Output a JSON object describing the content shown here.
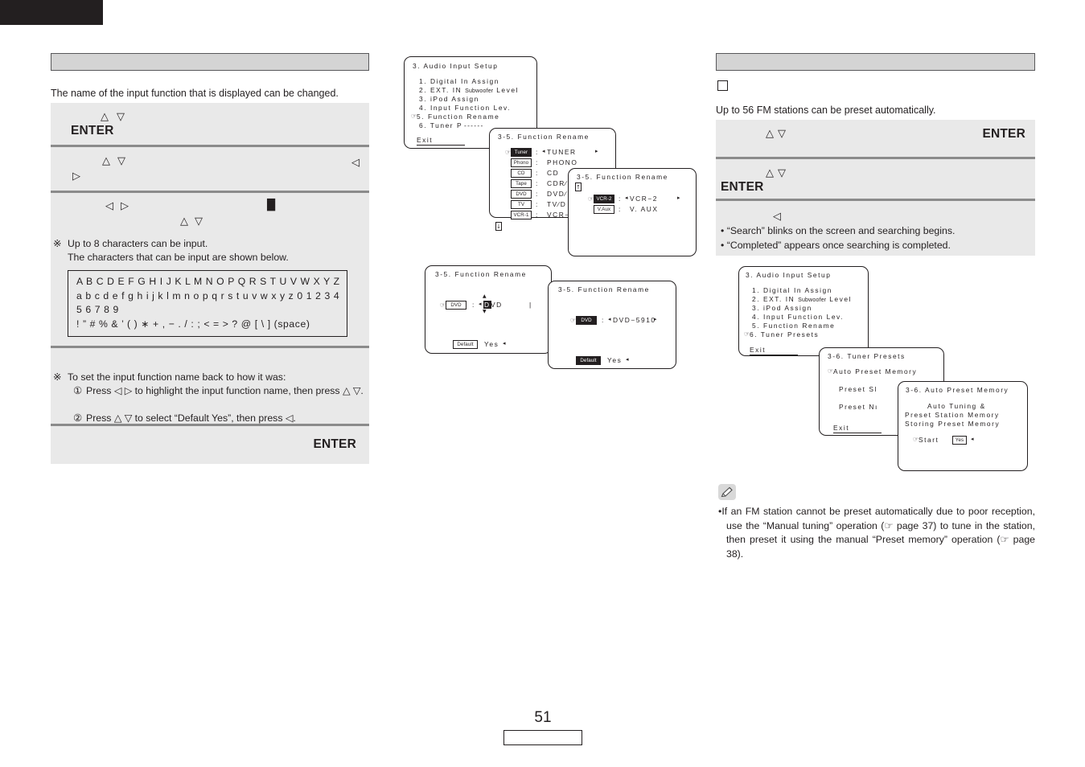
{
  "page": {
    "number": "51"
  },
  "left_column": {
    "header_label": "",
    "intro": "The name of the input function that is displayed can be changed.",
    "steps": [
      {
        "glyph_up": "△",
        "glyph_down": "▽",
        "enter": "ENTER"
      },
      {
        "glyph_up": "△",
        "glyph_down": "▽",
        "glyph_left": "◁",
        "glyph_right": "▷"
      },
      {
        "glyph_left": "◁",
        "glyph_right": "▷",
        "glyph_up": "△",
        "glyph_down": "▽",
        "cursor": "█"
      }
    ],
    "note_max_chars": {
      "mark": "※",
      "line1": "Up to 8 characters can be input.",
      "line2": "The characters that can be input are shown below."
    },
    "char_table": [
      "A B C D E F G H I J K L M N O P Q R S T U V W X Y Z",
      "a b c d e f g h i j k l m n o p q r s t u v w x y z 0 1 2 3 4",
      "5 6 7 8 9",
      "! ” # % & ’ ( ) ∗ + , − . / : ; < = > ? @ [ \\ ] (space)"
    ],
    "note_default": {
      "mark": "※",
      "intro": "To set the input function name back to how it was:",
      "item1_num": "①",
      "item1": "Press ◁ ▷ to highlight the input function name, then press △ ▽.",
      "item2_num": "②",
      "item2": "Press △ ▽ to select “Default Yes”, then press ◁."
    },
    "final_enter": "ENTER"
  },
  "right_column": {
    "header_label": "",
    "intro": "Up to 56 FM stations can be preset automatically.",
    "steps": [
      {
        "glyph_up": "△",
        "glyph_down": "▽",
        "enter": "ENTER"
      },
      {
        "glyph_up": "△",
        "glyph_down": "▽",
        "enter": "ENTER"
      },
      {
        "glyph_left": "◁",
        "bullet1": "“Search” blinks on the screen and searching begins.",
        "bullet2": "“Completed” appears once searching is completed."
      }
    ],
    "note": {
      "icon": "pencil-icon",
      "bullet": "•",
      "text": "If an FM station cannot be preset automatically due to poor reception, use the “Manual tuning” operation (☞ page 37) to tune in the station, then preset it using the manual “Preset memory” operation (☞ page 38)."
    }
  },
  "osd_screens": {
    "audio_input_setup_1": {
      "title": "3. Audio Input Setup",
      "items": [
        "1. Digital In Assign",
        "2. EXT. IN Subwoofer Level",
        "3. iPod Assign",
        "4. Input Function Lev.",
        "5. Function Rename",
        "6. Tuner P"
      ],
      "cursor_on": "5. Function Rename",
      "exit": "Exit"
    },
    "function_rename_list": {
      "title": "3-5. Function Rename",
      "rows": [
        {
          "tag": "Tuner",
          "sep": ":",
          "value": "TUNER",
          "left_arrow": "◂",
          "right_arrow": "▸",
          "selected": true
        },
        {
          "tag": "Phono",
          "sep": ":",
          "value": "PHONO"
        },
        {
          "tag": "CD",
          "sep": ":",
          "value": "CD"
        },
        {
          "tag": "Tape",
          "sep": ":",
          "value": "CDR∕"
        },
        {
          "tag": "DVD",
          "sep": ":",
          "value": "DVD∕"
        },
        {
          "tag": "TV",
          "sep": ":",
          "value": "TV∕D"
        },
        {
          "tag": "VCR-1",
          "sep": ":",
          "value": "VCR−"
        }
      ],
      "scroll_down": "↓"
    },
    "function_rename_vcr": {
      "title": "3-5. Function Rename",
      "scroll_up": "↑",
      "rows": [
        {
          "tag": "VCR-2",
          "sep": ":",
          "value": "VCR−2",
          "left_arrow": "◂",
          "right_arrow": "▸",
          "selected": true
        },
        {
          "tag": "V.Aux",
          "sep": ":",
          "value": "V. AUX"
        }
      ]
    },
    "function_rename_edit": {
      "title": "3-5. Function Rename",
      "tag": "DVD",
      "sep": ":",
      "left_arrow": "◂",
      "value_first": "D",
      "value_rest": "VD",
      "up_caret": "▲",
      "down_caret": "▼",
      "default_tag": "Default",
      "default_value": "Yes",
      "default_arrow": "◂"
    },
    "function_rename_done": {
      "title": "3-5. Function Rename",
      "tag": "DVD",
      "sep": ":",
      "left_arrow": "◂",
      "value": "DVD−5910",
      "right_arrow": "▸",
      "default_tag": "Default",
      "default_value": "Yes",
      "default_arrow": "◂"
    },
    "audio_input_setup_2": {
      "title": "3. Audio Input Setup",
      "items": [
        "1. Digital In Assign",
        "2. EXT. IN Subwoofer Level",
        "3. iPod Assign",
        "4. Input Function Lev.",
        "5. Function Rename",
        "6. Tuner Presets"
      ],
      "cursor_on": "6. Tuner Presets",
      "exit": "Exit"
    },
    "tuner_presets": {
      "title": "3-6. Tuner Presets",
      "items": [
        "Auto Preset Memory",
        "Preset Sl",
        "Preset Nı"
      ],
      "cursor_on": "Auto Preset Memory",
      "exit": "Exit"
    },
    "auto_preset_memory": {
      "title": "3-6. Auto Preset Memory",
      "line1": "Auto Tuning &",
      "line2": "Preset Station Memory",
      "line3": "Storing Preset Memory",
      "start_label": "Start",
      "start_value": "Yes",
      "start_arrow": "◂"
    }
  },
  "colors": {
    "ink": "#231f20",
    "header_fill": "#d4d4d4",
    "step_fill": "#e9e9e9",
    "divider": "#8b8b8b"
  }
}
